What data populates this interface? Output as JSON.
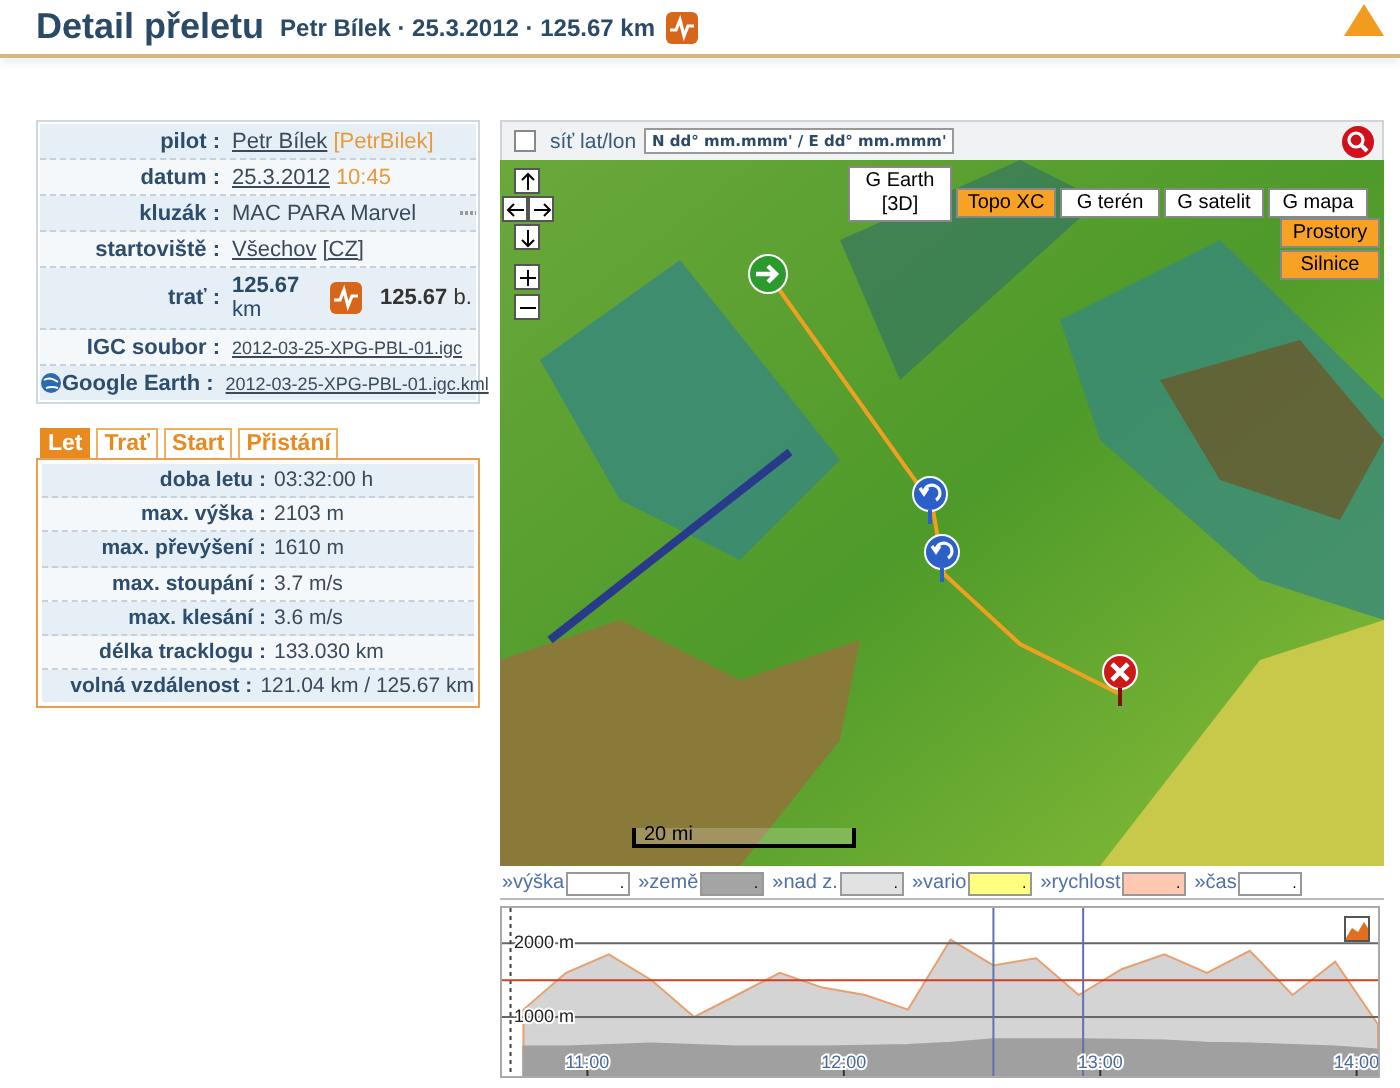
{
  "header": {
    "title": "Detail přeletu",
    "subtitle": "Petr Bílek · 25.3.2012 · 125.67 km"
  },
  "info": [
    {
      "label": "pilot :",
      "parts": [
        {
          "kind": "link",
          "text": "Petr Bílek"
        },
        {
          "kind": "accent",
          "text": "[PetrBilek]"
        }
      ]
    },
    {
      "label": "datum :",
      "parts": [
        {
          "kind": "link",
          "text": "25.3.2012"
        },
        {
          "kind": "accent",
          "text": "10:45"
        }
      ]
    },
    {
      "label": "kluzák :",
      "parts": [
        {
          "kind": "plain",
          "text": "MAC PARA Marvel"
        },
        {
          "kind": "more-icon"
        }
      ]
    },
    {
      "label": "startoviště :",
      "parts": [
        {
          "kind": "link",
          "text": "Všechov"
        },
        {
          "kind": "link",
          "text": "[CZ]"
        }
      ]
    },
    {
      "label": "trať :",
      "parts": [
        {
          "kind": "distance",
          "text": "**125.67** km"
        },
        {
          "kind": "graph-icon"
        },
        {
          "kind": "points",
          "text": "**125.67** b."
        }
      ]
    },
    {
      "label": "IGC soubor :",
      "parts": [
        {
          "kind": "file",
          "text": "2012-03-25-XPG-PBL-01.igc"
        }
      ]
    },
    {
      "label": "Google Earth :",
      "globe": true,
      "parts": [
        {
          "kind": "file",
          "text": "2012-03-25-XPG-PBL-01.igc.kml"
        }
      ]
    }
  ],
  "tabs": [
    {
      "label": "Let",
      "selected": true
    },
    {
      "label": "Trať",
      "selected": false
    },
    {
      "label": "Start",
      "selected": false
    },
    {
      "label": "Přistání",
      "selected": false
    }
  ],
  "stats": [
    {
      "label": "doba letu :",
      "value": "03:32:00 h"
    },
    {
      "label": "max. výška :",
      "value": "2103 m"
    },
    {
      "label": "max. převýšení :",
      "value": "1610 m"
    },
    {
      "label": "max. stoupání :",
      "value": "3.7 m/s"
    },
    {
      "label": "max. klesání :",
      "value": "3.6 m/s"
    },
    {
      "label": "délka tracklogu :",
      "value": "133.030 km"
    },
    {
      "label": "volná vzdálenost :",
      "value": "121.04 km / 125.67 km"
    }
  ],
  "map": {
    "grid": {
      "label": "síť lat/lon",
      "checked": false
    },
    "coord_field": {
      "value": "N dd° mm.mmm' / E dd° mm.mmm'"
    },
    "layers": [
      {
        "label": "G Earth [3D]",
        "selected": false
      },
      {
        "label": "Topo XC",
        "selected": true
      },
      {
        "label": "G terén",
        "selected": false
      },
      {
        "label": "G satelit",
        "selected": false
      },
      {
        "label": "G mapa",
        "selected": false
      }
    ],
    "overlays": [
      {
        "label": "Prostory",
        "on": true
      },
      {
        "label": "Silnice",
        "on": true
      }
    ],
    "scale": "20 mi"
  },
  "fields": [
    {
      "label": "»výška",
      "value": ".",
      "color": "#ffffff"
    },
    {
      "label": "»země",
      "value": ".",
      "color": "#a4a4a4"
    },
    {
      "label": "»nad z.",
      "value": ".",
      "color": "#e2e2e2"
    },
    {
      "label": "»vario",
      "value": ".",
      "color": "#ffff80"
    },
    {
      "label": "»rychlost",
      "value": ".",
      "color": "#ffc8b0"
    },
    {
      "label": "»čas",
      "value": ".",
      "color": "#ffffff"
    }
  ],
  "profile": {
    "chart_data": {
      "type": "area",
      "x": [
        645,
        655,
        665,
        675,
        685,
        695,
        705,
        715,
        725,
        735,
        745,
        755,
        765,
        775,
        785,
        795,
        805,
        815,
        825,
        835,
        845
      ],
      "series": [
        {
          "color": "#e8a070",
          "values": [
            1100,
            1600,
            1850,
            1500,
            1000,
            1300,
            1600,
            1400,
            1300,
            1100,
            2050,
            1700,
            1800,
            1300,
            1650,
            1850,
            1600,
            1900,
            1300,
            1750,
            900
          ]
        },
        {
          "color": "#a0a0a0",
          "values": [
            600,
            600,
            620,
            640,
            620,
            600,
            600,
            600,
            610,
            620,
            650,
            700,
            700,
            700,
            690,
            680,
            650,
            640,
            620,
            600,
            560
          ]
        }
      ],
      "xlim": [
        640,
        845
      ],
      "ylim": [
        200,
        2480
      ],
      "xticks": [
        {
          "value": 660,
          "label": "11:00"
        },
        {
          "value": 720,
          "label": "12:00"
        },
        {
          "value": 780,
          "label": "13:00"
        },
        {
          "value": 840,
          "label": "14:00"
        }
      ],
      "yticks": [
        {
          "value": 1000,
          "label": "1000 m"
        },
        {
          "value": 2000,
          "label": "2000 m"
        }
      ],
      "stacked": false,
      "ref_lines": [
        {
          "axis": "x",
          "value": 642,
          "color": "#444444"
        },
        {
          "axis": "y",
          "value": 1500,
          "color": "#d04020"
        },
        {
          "axis": "x",
          "value": 755,
          "color": "#6070b0"
        },
        {
          "axis": "x",
          "value": 776,
          "color": "#6070b0"
        }
      ]
    }
  }
}
